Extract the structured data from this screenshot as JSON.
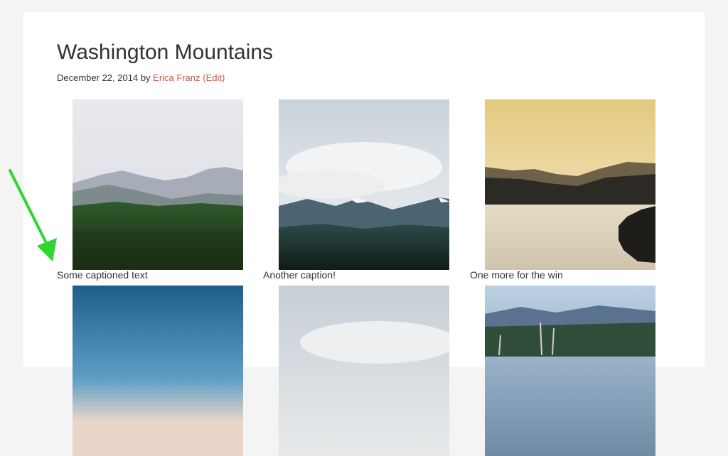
{
  "post": {
    "title": "Washington Mountains",
    "date": "December 22, 2014",
    "by": "by",
    "author": "Erica Franz",
    "edit": "(Edit)"
  },
  "gallery": {
    "row1": [
      {
        "alt": "misty forested mountain valley",
        "caption": "Some captioned text"
      },
      {
        "alt": "clouds over mountain range and forest",
        "caption": "Another caption!"
      },
      {
        "alt": "lake with islands at golden sunset",
        "caption": "One more for the win"
      }
    ],
    "row2": [
      {
        "alt": "blue sky over horizon"
      },
      {
        "alt": "pale cloudy sky"
      },
      {
        "alt": "wildflowers with blurred mountains"
      }
    ]
  },
  "annotation": {
    "arrow_color": "#2fd62f",
    "icon": "arrow-down-right-icon"
  },
  "colors": {
    "link": "#c3594d",
    "text": "#333333",
    "background": "#f4f4f4"
  }
}
